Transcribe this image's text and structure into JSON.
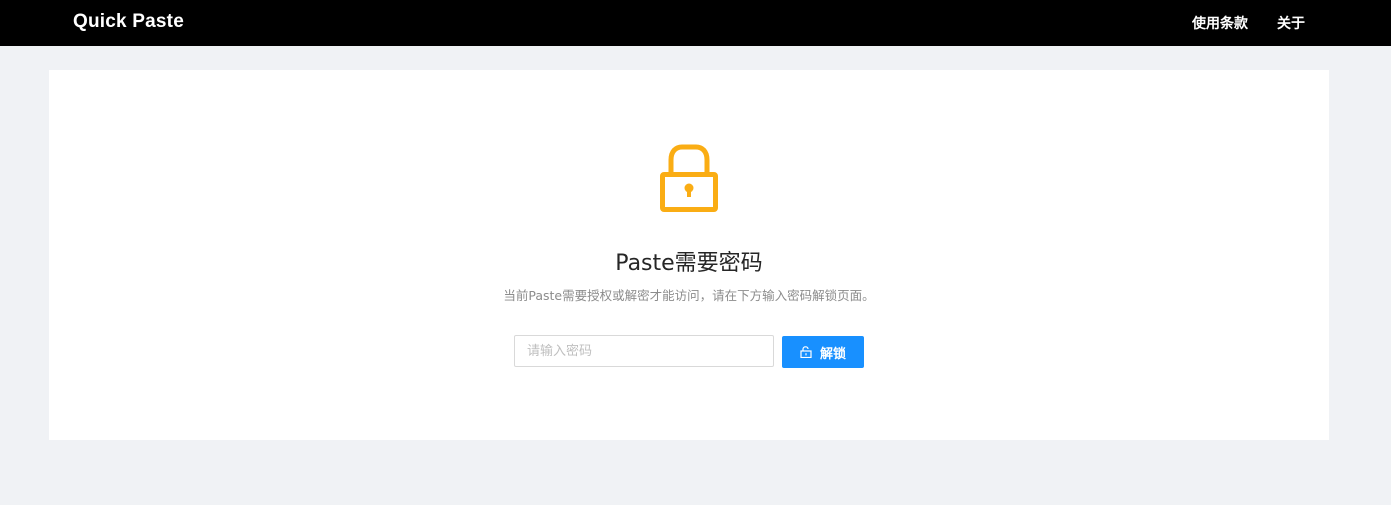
{
  "navbar": {
    "brand": "Quick Paste",
    "links": [
      "使用条款",
      "关于"
    ]
  },
  "lock": {
    "icon": "lock-icon",
    "color": "#faad14",
    "title": "Paste需要密码",
    "description": "当前Paste需要授权或解密才能访问，请在下方输入密码解锁页面。"
  },
  "form": {
    "password_value": "",
    "password_placeholder": "请输入密码",
    "unlock_label": "解锁",
    "unlock_icon": "unlock-icon",
    "button_color": "#1890ff"
  }
}
